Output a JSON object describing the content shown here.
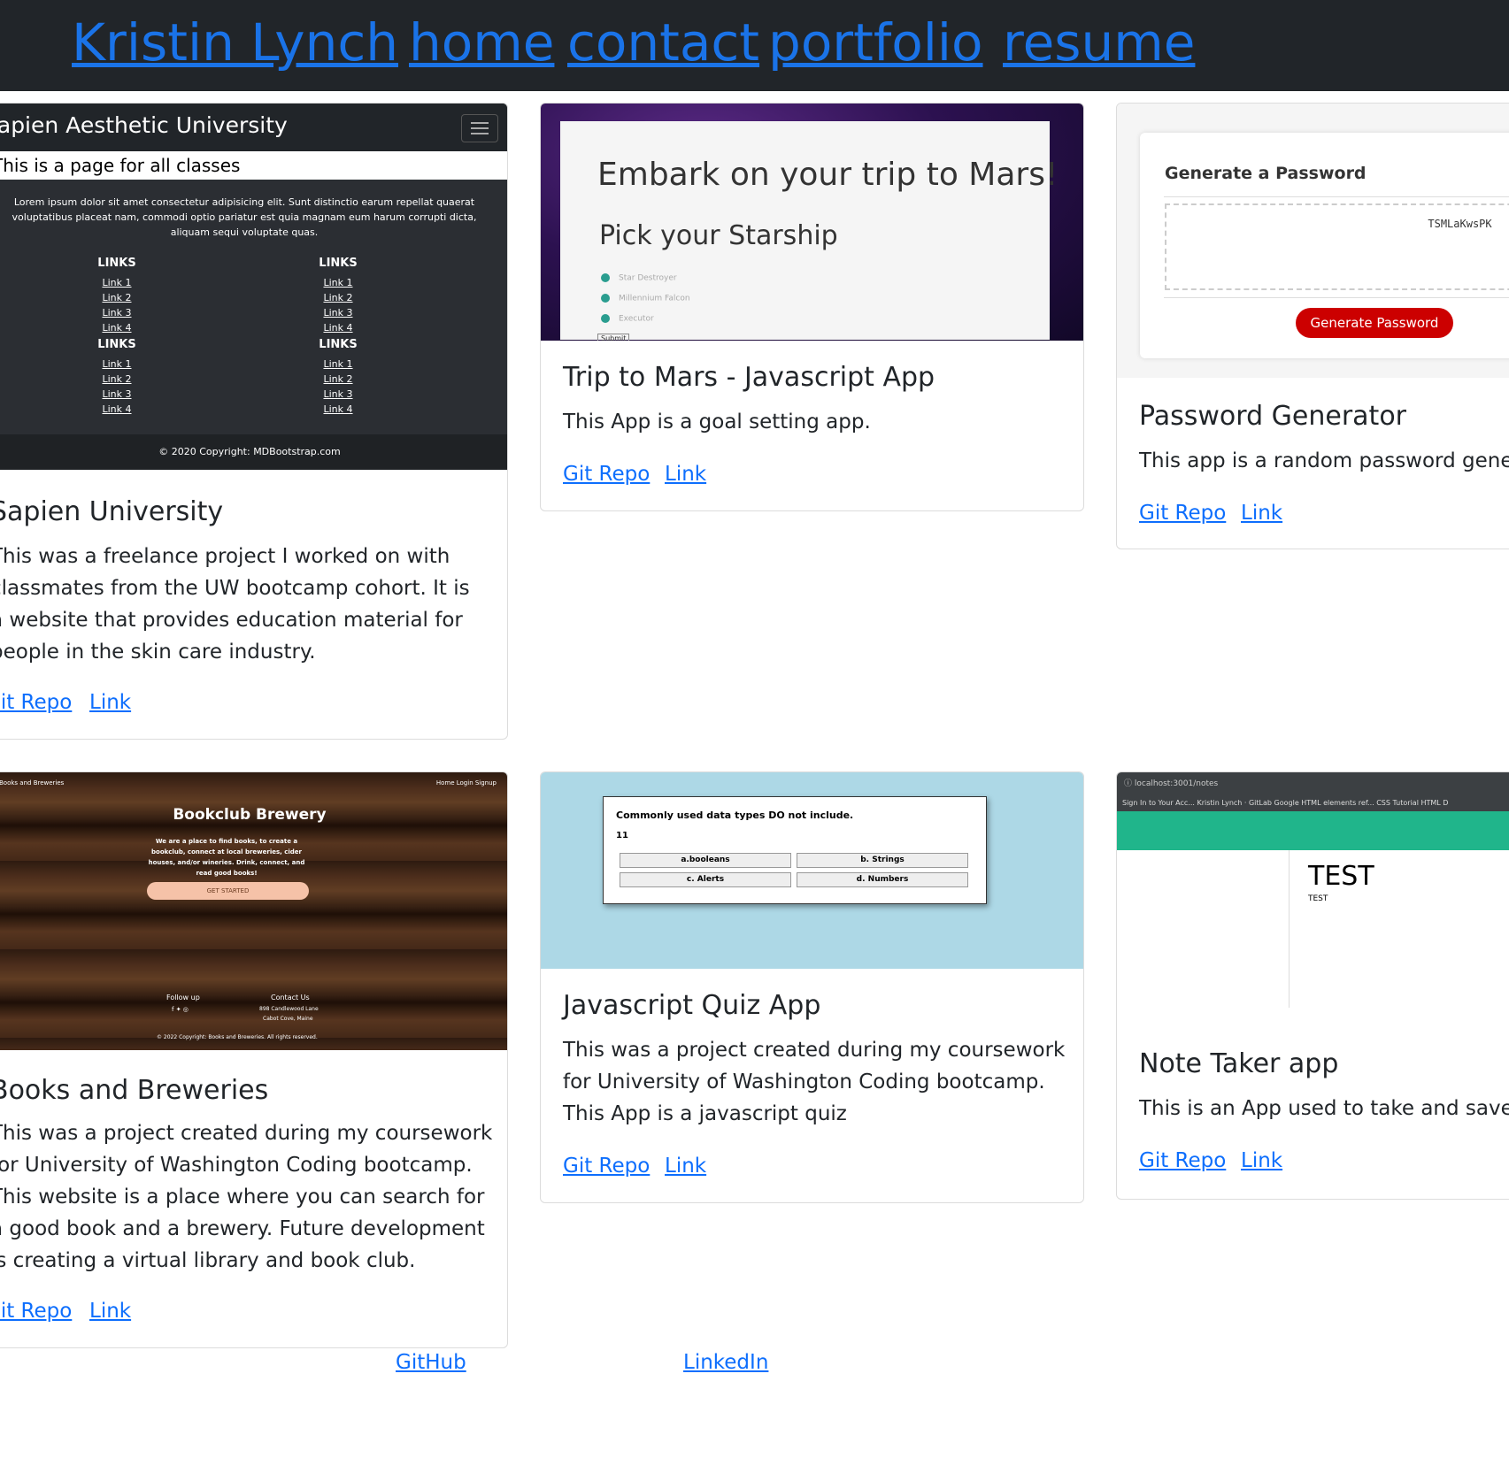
{
  "nav": {
    "brand": "Kristin Lynch",
    "links": [
      "home",
      "contact",
      "portfolio",
      "resume"
    ]
  },
  "cards": [
    {
      "title": "Sapien University",
      "text": "This was a freelance project I worked on with classmates from the UW bootcamp cohort. It is a website that provides education material for people in the skin care industry.",
      "git_label": "Git Repo",
      "link_label": "Link",
      "shot": {
        "brand": "Sapien Aesthetic University",
        "subtitle": "This is a page for all classes",
        "lorem": "Lorem ipsum dolor sit amet consectetur adipisicing elit. Sunt distinctio earum repellat quaerat voluptatibus placeat nam, commodi optio pariatur est quia magnam eum harum corrupti dicta, aliquam sequi voluptate quas.",
        "links_heading": "LINKS",
        "links": [
          "Link 1",
          "Link 2",
          "Link 3",
          "Link 4"
        ],
        "footer": "© 2020 Copyright: MDBootstrap.com"
      }
    },
    {
      "title": "Trip to Mars - Javascript App",
      "text": "This App is a goal setting app.",
      "git_label": "Git Repo",
      "link_label": "Link",
      "shot": {
        "heading": "Embark on your trip to Mars!",
        "subheading": "Pick your Starship",
        "options": [
          "Star Destroyer",
          "Millennium Falcon",
          "Executor"
        ],
        "submit": "Submit"
      }
    },
    {
      "title": "Password Generator",
      "text": "This app is a random password generator",
      "git_label": "Git Repo",
      "link_label": "Link",
      "shot": {
        "heading": "Generate a Password",
        "password": "TSMLaKwsPK",
        "button": "Generate Password"
      }
    },
    {
      "title": "Books and Breweries",
      "text": "This was a project created during my coursework for University of Washington Coding bootcamp. This website is a place where you can search for a good book and a brewery. Future development is creating a virtual library and book club.",
      "git_label": "Git Repo",
      "link_label": "Link",
      "shot": {
        "brand": "Books and Breweries",
        "nav": "Home   Login   Signup",
        "title": "Bookclub Brewery",
        "desc": "We are a place to find books, to create a bookclub, connect at local breweries, cider houses, and/or wineries. Drink, connect, and read good books!",
        "button": "GET STARTED",
        "follow": "Follow up",
        "contact": "Contact Us",
        "address1": "898 Candlewood Lane",
        "address2": "Cabot Cove, Maine",
        "copyright": "© 2022 Copyright: Books and Breweries. All rights reserved."
      }
    },
    {
      "title": "Javascript Quiz App",
      "text": "This was a project created during my coursework for University of Washington Coding bootcamp. This App is a javascript quiz",
      "git_label": "Git Repo",
      "link_label": "Link",
      "shot": {
        "question": "Commonly used data types DO not include.",
        "number": "11",
        "answers": [
          "a.booleans",
          "b. Strings",
          "c. Alerts",
          "d. Numbers"
        ]
      }
    },
    {
      "title": "Note Taker app",
      "text": "This is an App used to take and save notes",
      "git_label": "Git Repo",
      "link_label": "Link",
      "shot": {
        "url": "localhost:3001/notes",
        "bookmarks": "Sign In to Your Acc...   Kristin Lynch · GitLab   Google   HTML elements ref...   CSS Tutorial   HTML D",
        "note_title": "TEST",
        "note_text": "TEST"
      }
    }
  ],
  "footer": {
    "github": "GitHub",
    "linkedin": "LinkedIn"
  },
  "colors": {
    "navbar_bg": "#212529",
    "link": "#0d6efd",
    "password_button": "#cc0000",
    "quiz_bg": "#add8e6",
    "note_header": "#20b58b"
  }
}
